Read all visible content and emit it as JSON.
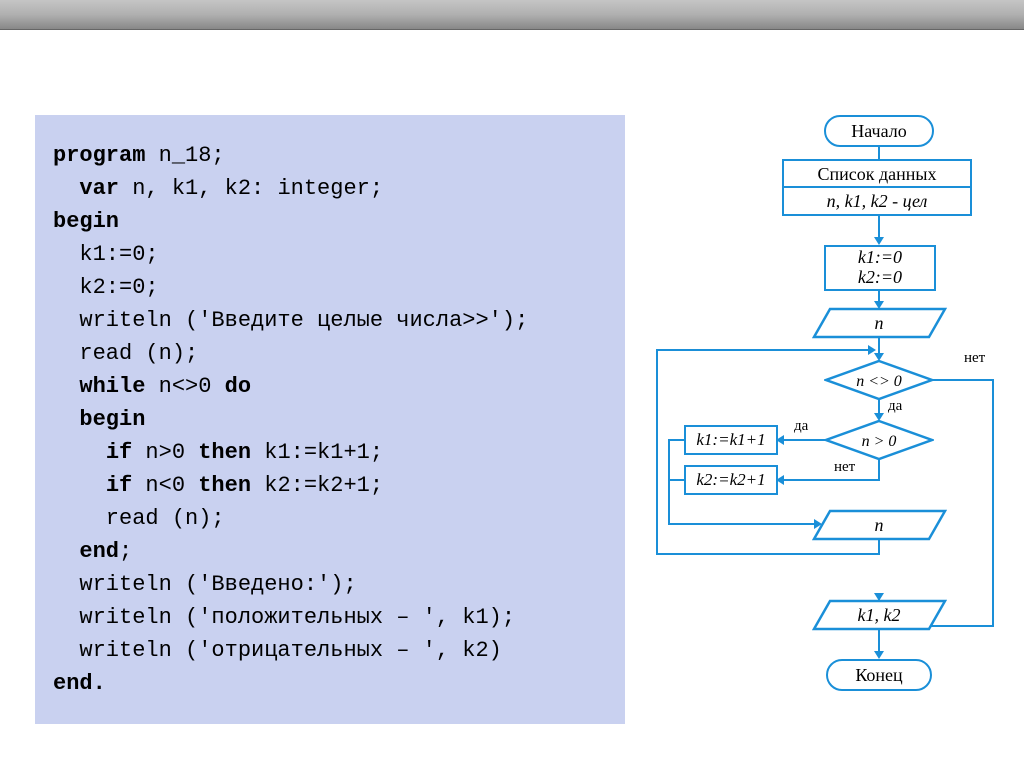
{
  "code": {
    "l1": "program n_18;",
    "l2": "  var n, k1, k2: integer;",
    "l3": "begin",
    "l4": "  k1:=0;",
    "l5": "  k2:=0;",
    "l6": "  writeln ('Введите целые числа>>');",
    "l7": "  read (n);",
    "l8": "  while n<>0 do",
    "l9": "  begin",
    "l10": "    if n>0 then k1:=k1+1;",
    "l11": "    if n<0 then k2:=k2+1;",
    "l12": "    read (n);",
    "l13": "  end;",
    "l14": "  writeln ('Введено:');",
    "l15": "  writeln ('положительных – ', k1);",
    "l16": "  writeln ('отрицательных – ', k2)",
    "l17": "end."
  },
  "flow": {
    "start": "Начало",
    "list": "Список данных",
    "vars": "n, k1, k2 - цел",
    "init": "k1:=0\nk2:=0",
    "input_n": "n",
    "cond1": "n <> 0",
    "cond2": "n > 0",
    "k1": "k1:=k1+1",
    "k2": "k2:=k2+1",
    "input_n2": "n",
    "output": "k1, k2",
    "end": "Конец",
    "yes": "да",
    "no": "нет"
  }
}
